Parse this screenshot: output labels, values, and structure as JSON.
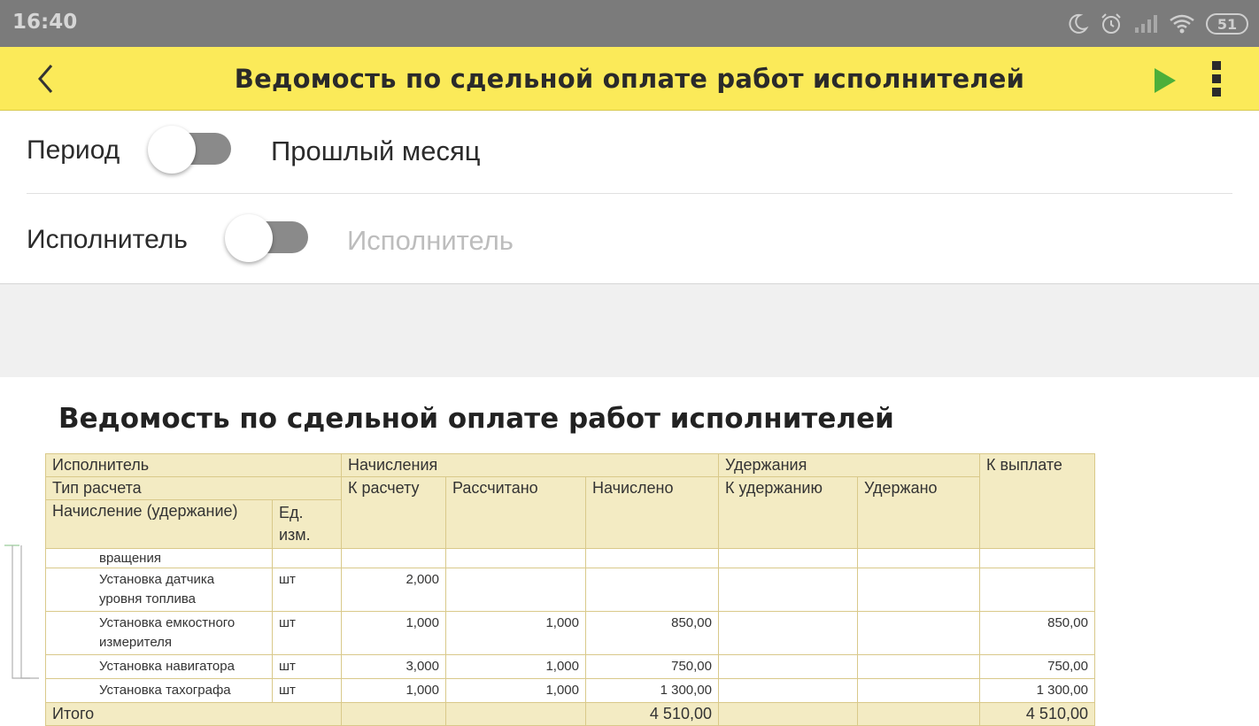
{
  "status_bar": {
    "time": "16:40",
    "battery": "51"
  },
  "app_bar": {
    "title": "Ведомость по сдельной оплате работ исполнителей"
  },
  "filters": {
    "period": {
      "label": "Период",
      "value": "Прошлый месяц"
    },
    "performer": {
      "label": "Исполнитель",
      "placeholder": "Исполнитель"
    }
  },
  "report": {
    "title": "Ведомость по сдельной оплате работ исполнителей",
    "headers": {
      "performer": "Исполнитель",
      "calc_type": "Тип расчета",
      "accrual": "Начисление (удержание)",
      "unit": "Ед. изм.",
      "accruals": "Начисления",
      "to_calc": "К расчету",
      "calculated": "Рассчитано",
      "accrued": "Начислено",
      "deductions": "Удержания",
      "to_deduct": "К удержанию",
      "deducted": "Удержано",
      "to_pay": "К выплате"
    },
    "rows": [
      {
        "name": "вращения",
        "unit": "",
        "to_calc": "",
        "calculated": "",
        "accrued": "",
        "to_deduct": "",
        "deducted": "",
        "to_pay": ""
      },
      {
        "name": "Установка датчика уровня топлива",
        "name_l1": "Установка датчика",
        "name_l2": "уровня топлива",
        "unit": "шт",
        "to_calc": "2,000",
        "calculated": "",
        "accrued": "",
        "to_deduct": "",
        "deducted": "",
        "to_pay": ""
      },
      {
        "name": "Установка емкостного измерителя",
        "name_l1": "Установка емкостного",
        "name_l2": "измерителя",
        "unit": "шт",
        "to_calc": "1,000",
        "calculated": "1,000",
        "accrued": "850,00",
        "to_deduct": "",
        "deducted": "",
        "to_pay": "850,00"
      },
      {
        "name": "Установка навигатора",
        "unit": "шт",
        "to_calc": "3,000",
        "calculated": "1,000",
        "accrued": "750,00",
        "to_deduct": "",
        "deducted": "",
        "to_pay": "750,00"
      },
      {
        "name": "Установка тахографа",
        "unit": "шт",
        "to_calc": "1,000",
        "calculated": "1,000",
        "accrued": "1 300,00",
        "to_deduct": "",
        "deducted": "",
        "to_pay": "1 300,00"
      }
    ],
    "total": {
      "label": "Итого",
      "accrued": "4 510,00",
      "to_pay": "4 510,00"
    }
  },
  "colors": {
    "app_bar": "#fbea59",
    "play": "#4caf3a",
    "table_header": "#f3ebc3",
    "table_border": "#d9c98a"
  }
}
